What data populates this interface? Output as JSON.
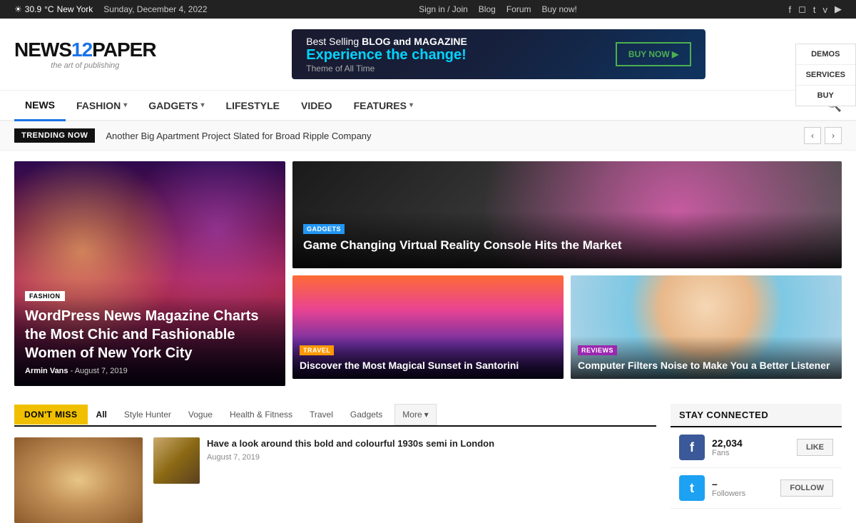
{
  "topbar": {
    "weather": "30.9",
    "weather_unit": "C",
    "location": "New York",
    "date": "Sunday, December 4, 2022",
    "links": [
      "Sign in / Join",
      "Blog",
      "Forum",
      "Buy now!"
    ],
    "social": [
      "facebook",
      "instagram",
      "twitter",
      "vimeo",
      "youtube"
    ]
  },
  "header": {
    "logo_main": "NEWS",
    "logo_num": "12",
    "logo_end": "PAPER",
    "tagline": "the art of publishing",
    "ad": {
      "line1_pre": "Best Selling ",
      "line1_bold": "BLOG and MAGAZINE",
      "line2": "Experience the change!",
      "line3": "Theme of All Time",
      "button": "BUY NOW ▶"
    }
  },
  "sidebar_nav": {
    "items": [
      "DEMOS",
      "SERVICES",
      "BUY"
    ]
  },
  "nav": {
    "items": [
      {
        "label": "NEWS",
        "active": true,
        "has_arrow": false
      },
      {
        "label": "FASHION",
        "active": false,
        "has_arrow": true
      },
      {
        "label": "GADGETS",
        "active": false,
        "has_arrow": true
      },
      {
        "label": "LIFESTYLE",
        "active": false,
        "has_arrow": false
      },
      {
        "label": "VIDEO",
        "active": false,
        "has_arrow": false
      },
      {
        "label": "FEATURES",
        "active": false,
        "has_arrow": true
      }
    ]
  },
  "trending": {
    "label": "TRENDING NOW",
    "text": "Another Big Apartment Project Slated for Broad Ripple Company"
  },
  "featured": {
    "large": {
      "category": "FASHION",
      "title": "WordPress News Magazine Charts the Most Chic and Fashionable Women of New York City",
      "author": "Armin Vans",
      "date": "August 7, 2019"
    },
    "top_right": {
      "category": "GADGETS",
      "title": "Game Changing Virtual Reality Console Hits the Market"
    },
    "bottom_left": {
      "category": "TRAVEL",
      "title": "Discover the Most Magical Sunset in Santorini"
    },
    "bottom_right": {
      "category": "REVIEWS",
      "title": "Computer Filters Noise to Make You a Better Listener"
    }
  },
  "dont_miss": {
    "label": "DON'T MISS",
    "tabs": [
      "All",
      "Style Hunter",
      "Vogue",
      "Health & Fitness",
      "Travel",
      "Gadgets",
      "More"
    ],
    "article": {
      "title": "Have a look around this bold and colourful 1930s semi in London",
      "date": "August 7, 2019"
    }
  },
  "stay_connected": {
    "title": "STAY CONNECTED",
    "facebook": {
      "count": "22,034",
      "label": "Fans",
      "action": "LIKE"
    },
    "twitter": {
      "count": "–",
      "label": "Followers",
      "action": "FOLLOW"
    }
  }
}
